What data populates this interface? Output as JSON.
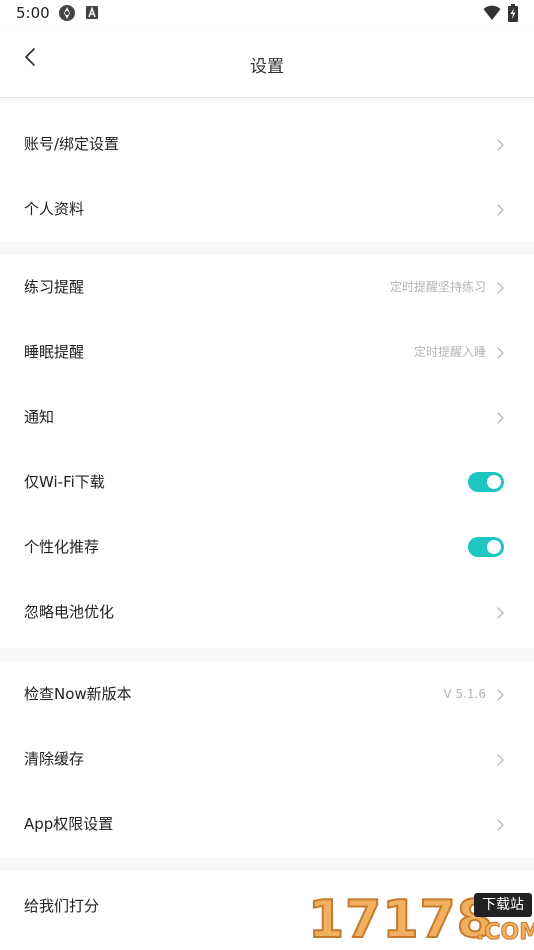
{
  "status_bar": {
    "time": "5:00",
    "icons": [
      "aperture-icon",
      "a-badge-icon",
      "wifi-icon",
      "battery-charging-icon"
    ]
  },
  "header": {
    "title": "设置",
    "back_icon": "chevron-left-icon"
  },
  "groups": [
    {
      "items": [
        {
          "label": "账号/绑定设置",
          "value": "",
          "control": "chevron"
        },
        {
          "label": "个人资料",
          "value": "",
          "control": "chevron"
        }
      ]
    },
    {
      "items": [
        {
          "label": "练习提醒",
          "value": "定时提醒坚持练习",
          "control": "chevron"
        },
        {
          "label": "睡眠提醒",
          "value": "定时提醒入睡",
          "control": "chevron"
        },
        {
          "label": "通知",
          "value": "",
          "control": "chevron"
        },
        {
          "label": "仅Wi-Fi下载",
          "value": "",
          "control": "toggle",
          "on": true
        },
        {
          "label": "个性化推荐",
          "value": "",
          "control": "toggle",
          "on": true
        },
        {
          "label": "忽略电池优化",
          "value": "",
          "control": "chevron"
        }
      ]
    },
    {
      "items": [
        {
          "label": "检查Now新版本",
          "value": "V 5.1.6",
          "control": "chevron"
        },
        {
          "label": "清除缓存",
          "value": "",
          "control": "chevron"
        },
        {
          "label": "App权限设置",
          "value": "",
          "control": "chevron"
        }
      ]
    },
    {
      "items": [
        {
          "label": "给我们打分",
          "value": "",
          "control": "none"
        }
      ]
    }
  ],
  "colors": {
    "toggle_on": "#1fc5c0",
    "divider_gap": "#f7f7f8",
    "secondary_text": "#b5b5b5"
  },
  "watermark": {
    "digits": "17178",
    "badge": "下载站",
    "suffix": ".COM"
  }
}
